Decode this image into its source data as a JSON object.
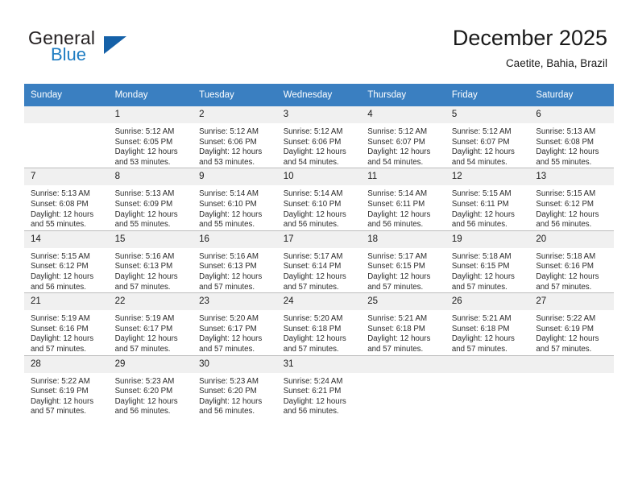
{
  "brand": {
    "name_top": "General",
    "name_bottom": "Blue",
    "triangle_color": "#1561a8",
    "blue_color": "#1d7cc2"
  },
  "header": {
    "title": "December 2025",
    "subtitle": "Caetite, Bahia, Brazil"
  },
  "theme": {
    "header_row_bg": "#3a7fc1",
    "daynum_bg": "#f0f0f0",
    "grid_line": "#bcbcbc",
    "text": "#1a1a1a"
  },
  "weekdays": [
    "Sunday",
    "Monday",
    "Tuesday",
    "Wednesday",
    "Thursday",
    "Friday",
    "Saturday"
  ],
  "labels": {
    "sunrise_prefix": "Sunrise:",
    "sunset_prefix": "Sunset:",
    "daylight_prefix": "Daylight:"
  },
  "weeks": [
    [
      {
        "day": "",
        "blank": true,
        "l1": "",
        "l2": "",
        "l3": "",
        "l4": ""
      },
      {
        "day": "1",
        "l1": "Sunrise: 5:12 AM",
        "l2": "Sunset: 6:05 PM",
        "l3": "Daylight: 12 hours",
        "l4": "and 53 minutes."
      },
      {
        "day": "2",
        "l1": "Sunrise: 5:12 AM",
        "l2": "Sunset: 6:06 PM",
        "l3": "Daylight: 12 hours",
        "l4": "and 53 minutes."
      },
      {
        "day": "3",
        "l1": "Sunrise: 5:12 AM",
        "l2": "Sunset: 6:06 PM",
        "l3": "Daylight: 12 hours",
        "l4": "and 54 minutes."
      },
      {
        "day": "4",
        "l1": "Sunrise: 5:12 AM",
        "l2": "Sunset: 6:07 PM",
        "l3": "Daylight: 12 hours",
        "l4": "and 54 minutes."
      },
      {
        "day": "5",
        "l1": "Sunrise: 5:12 AM",
        "l2": "Sunset: 6:07 PM",
        "l3": "Daylight: 12 hours",
        "l4": "and 54 minutes."
      },
      {
        "day": "6",
        "l1": "Sunrise: 5:13 AM",
        "l2": "Sunset: 6:08 PM",
        "l3": "Daylight: 12 hours",
        "l4": "and 55 minutes."
      }
    ],
    [
      {
        "day": "7",
        "l1": "Sunrise: 5:13 AM",
        "l2": "Sunset: 6:08 PM",
        "l3": "Daylight: 12 hours",
        "l4": "and 55 minutes."
      },
      {
        "day": "8",
        "l1": "Sunrise: 5:13 AM",
        "l2": "Sunset: 6:09 PM",
        "l3": "Daylight: 12 hours",
        "l4": "and 55 minutes."
      },
      {
        "day": "9",
        "l1": "Sunrise: 5:14 AM",
        "l2": "Sunset: 6:10 PM",
        "l3": "Daylight: 12 hours",
        "l4": "and 55 minutes."
      },
      {
        "day": "10",
        "l1": "Sunrise: 5:14 AM",
        "l2": "Sunset: 6:10 PM",
        "l3": "Daylight: 12 hours",
        "l4": "and 56 minutes."
      },
      {
        "day": "11",
        "l1": "Sunrise: 5:14 AM",
        "l2": "Sunset: 6:11 PM",
        "l3": "Daylight: 12 hours",
        "l4": "and 56 minutes."
      },
      {
        "day": "12",
        "l1": "Sunrise: 5:15 AM",
        "l2": "Sunset: 6:11 PM",
        "l3": "Daylight: 12 hours",
        "l4": "and 56 minutes."
      },
      {
        "day": "13",
        "l1": "Sunrise: 5:15 AM",
        "l2": "Sunset: 6:12 PM",
        "l3": "Daylight: 12 hours",
        "l4": "and 56 minutes."
      }
    ],
    [
      {
        "day": "14",
        "l1": "Sunrise: 5:15 AM",
        "l2": "Sunset: 6:12 PM",
        "l3": "Daylight: 12 hours",
        "l4": "and 56 minutes."
      },
      {
        "day": "15",
        "l1": "Sunrise: 5:16 AM",
        "l2": "Sunset: 6:13 PM",
        "l3": "Daylight: 12 hours",
        "l4": "and 57 minutes."
      },
      {
        "day": "16",
        "l1": "Sunrise: 5:16 AM",
        "l2": "Sunset: 6:13 PM",
        "l3": "Daylight: 12 hours",
        "l4": "and 57 minutes."
      },
      {
        "day": "17",
        "l1": "Sunrise: 5:17 AM",
        "l2": "Sunset: 6:14 PM",
        "l3": "Daylight: 12 hours",
        "l4": "and 57 minutes."
      },
      {
        "day": "18",
        "l1": "Sunrise: 5:17 AM",
        "l2": "Sunset: 6:15 PM",
        "l3": "Daylight: 12 hours",
        "l4": "and 57 minutes."
      },
      {
        "day": "19",
        "l1": "Sunrise: 5:18 AM",
        "l2": "Sunset: 6:15 PM",
        "l3": "Daylight: 12 hours",
        "l4": "and 57 minutes."
      },
      {
        "day": "20",
        "l1": "Sunrise: 5:18 AM",
        "l2": "Sunset: 6:16 PM",
        "l3": "Daylight: 12 hours",
        "l4": "and 57 minutes."
      }
    ],
    [
      {
        "day": "21",
        "l1": "Sunrise: 5:19 AM",
        "l2": "Sunset: 6:16 PM",
        "l3": "Daylight: 12 hours",
        "l4": "and 57 minutes."
      },
      {
        "day": "22",
        "l1": "Sunrise: 5:19 AM",
        "l2": "Sunset: 6:17 PM",
        "l3": "Daylight: 12 hours",
        "l4": "and 57 minutes."
      },
      {
        "day": "23",
        "l1": "Sunrise: 5:20 AM",
        "l2": "Sunset: 6:17 PM",
        "l3": "Daylight: 12 hours",
        "l4": "and 57 minutes."
      },
      {
        "day": "24",
        "l1": "Sunrise: 5:20 AM",
        "l2": "Sunset: 6:18 PM",
        "l3": "Daylight: 12 hours",
        "l4": "and 57 minutes."
      },
      {
        "day": "25",
        "l1": "Sunrise: 5:21 AM",
        "l2": "Sunset: 6:18 PM",
        "l3": "Daylight: 12 hours",
        "l4": "and 57 minutes."
      },
      {
        "day": "26",
        "l1": "Sunrise: 5:21 AM",
        "l2": "Sunset: 6:18 PM",
        "l3": "Daylight: 12 hours",
        "l4": "and 57 minutes."
      },
      {
        "day": "27",
        "l1": "Sunrise: 5:22 AM",
        "l2": "Sunset: 6:19 PM",
        "l3": "Daylight: 12 hours",
        "l4": "and 57 minutes."
      }
    ],
    [
      {
        "day": "28",
        "l1": "Sunrise: 5:22 AM",
        "l2": "Sunset: 6:19 PM",
        "l3": "Daylight: 12 hours",
        "l4": "and 57 minutes."
      },
      {
        "day": "29",
        "l1": "Sunrise: 5:23 AM",
        "l2": "Sunset: 6:20 PM",
        "l3": "Daylight: 12 hours",
        "l4": "and 56 minutes."
      },
      {
        "day": "30",
        "l1": "Sunrise: 5:23 AM",
        "l2": "Sunset: 6:20 PM",
        "l3": "Daylight: 12 hours",
        "l4": "and 56 minutes."
      },
      {
        "day": "31",
        "l1": "Sunrise: 5:24 AM",
        "l2": "Sunset: 6:21 PM",
        "l3": "Daylight: 12 hours",
        "l4": "and 56 minutes."
      },
      {
        "day": "",
        "blank": true,
        "l1": "",
        "l2": "",
        "l3": "",
        "l4": ""
      },
      {
        "day": "",
        "blank": true,
        "l1": "",
        "l2": "",
        "l3": "",
        "l4": ""
      },
      {
        "day": "",
        "blank": true,
        "l1": "",
        "l2": "",
        "l3": "",
        "l4": ""
      }
    ]
  ]
}
